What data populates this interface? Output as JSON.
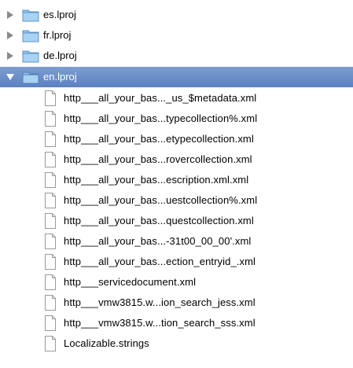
{
  "folders": [
    {
      "label": "es.lproj",
      "expanded": false
    },
    {
      "label": "fr.lproj",
      "expanded": false
    },
    {
      "label": "de.lproj",
      "expanded": false
    },
    {
      "label": "en.lproj",
      "expanded": true,
      "selected": true
    }
  ],
  "files": [
    "http___all_your_bas..._us_$metadata.xml",
    "http___all_your_bas...typecollection%.xml",
    "http___all_your_bas...etypecollection.xml",
    "http___all_your_bas...rovercollection.xml",
    "http___all_your_bas...escription.xml.xml",
    "http___all_your_bas...uestcollection%.xml",
    "http___all_your_bas...questcollection.xml",
    "http___all_your_bas...-31t00_00_00'.xml",
    "http___all_your_bas...ection_entryid_.xml",
    "http___servicedocument.xml",
    "http___vmw3815.w...ion_search_jess.xml",
    "http___vmw3815.w...tion_search_sss.xml",
    "Localizable.strings"
  ],
  "colors": {
    "selection": "#6a8dcb",
    "folder": "#7fb7e6"
  },
  "icons": {
    "folder": "folder-icon",
    "file": "document-icon",
    "collapsed": "disclosure-triangle-right-icon",
    "expanded": "disclosure-triangle-down-icon"
  }
}
